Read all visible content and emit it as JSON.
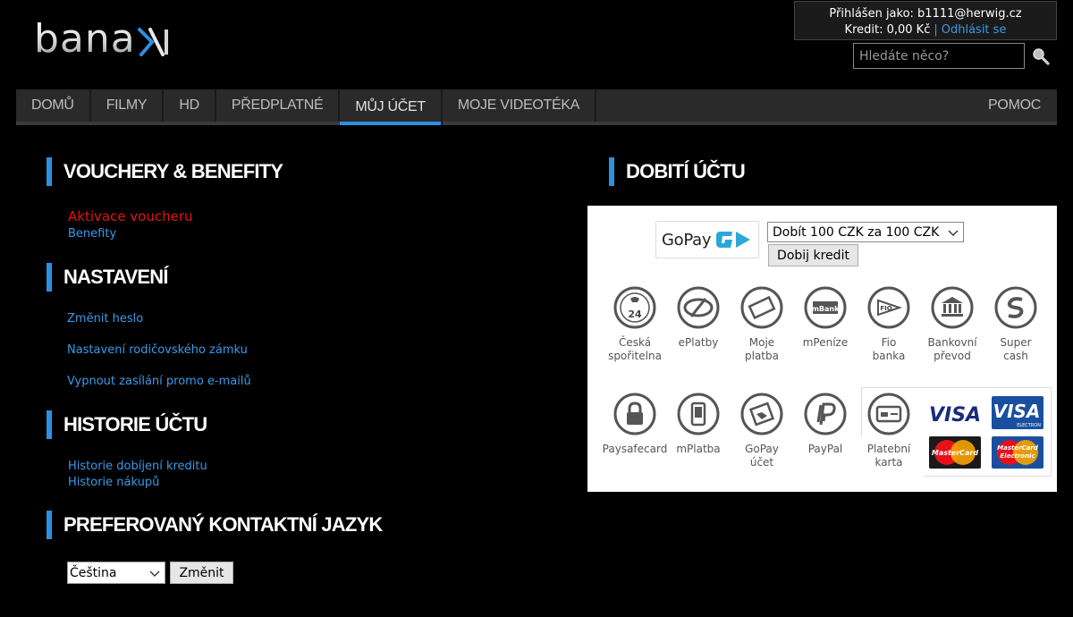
{
  "logo": {
    "text": "bana",
    "x_glyph": "X",
    "icon": "banaxi-x-icon"
  },
  "user": {
    "logged_in_label": "Přihlášen jako: b1111@herwig.cz",
    "credit_label": "Kredit: 0,00 Kč",
    "separator": "|",
    "logout_label": "Odhlásit se"
  },
  "search": {
    "placeholder": "Hledáte něco?",
    "icon": "search-icon"
  },
  "nav": {
    "items": [
      "DOMŮ",
      "FILMY",
      "HD",
      "PŘEDPLATNÉ",
      "MŮJ ÚČET",
      "MOJE VIDEOTÉKA"
    ],
    "active": "MŮJ ÚČET",
    "help": "POMOC"
  },
  "vouchers": {
    "title": "VOUCHERY & BENEFITY",
    "activate": "Aktivace voucheru",
    "benefits": "Benefity"
  },
  "settings": {
    "title": "NASTAVENÍ",
    "links": [
      "Změnit heslo",
      "Nastavení rodičovského zámku",
      "Vypnout zasílání promo e-mailů"
    ]
  },
  "history": {
    "title": "HISTORIE ÚČTU",
    "links": [
      "Historie dobíjení kreditu",
      "Historie nákupů"
    ]
  },
  "language": {
    "title": "PREFEROVANÝ KONTAKTNÍ JAZYK",
    "selected": "Čeština",
    "button": "Změnit"
  },
  "topup": {
    "title": "DOBITÍ ÚČTU",
    "gopay_label": "GoPay",
    "amount_selected": "Dobít 100 CZK za 100 CZK",
    "button": "Dobij kredit",
    "methods_row1": [
      {
        "label": "Česká\nspořitelna",
        "icon": "ceska-sporitelna-icon",
        "glyph": "24"
      },
      {
        "label": "ePlatby",
        "icon": "eplatby-icon"
      },
      {
        "label": "Moje\nplatba",
        "icon": "moje-platba-icon"
      },
      {
        "label": "mPeníze",
        "icon": "mpenize-icon",
        "glyph": "mBank"
      },
      {
        "label": "Fio\nbanka",
        "icon": "fio-banka-icon",
        "glyph": "FIO"
      },
      {
        "label": "Bankovní\npřevod",
        "icon": "bank-transfer-icon"
      },
      {
        "label": "Super\ncash",
        "icon": "super-cash-icon"
      }
    ],
    "methods_row2": [
      {
        "label": "Paysafecard",
        "icon": "paysafecard-icon"
      },
      {
        "label": "mPlatba",
        "icon": "mplatba-icon"
      },
      {
        "label": "GoPay\núčet",
        "icon": "gopay-account-icon"
      },
      {
        "label": "PayPal",
        "icon": "paypal-icon"
      },
      {
        "label": "Platební\nkarta",
        "icon": "payment-card-icon"
      }
    ],
    "card_logos": [
      "VISA",
      "VISA",
      "ELECTRON",
      "MasterCard",
      "MasterCard",
      "Electronic"
    ]
  },
  "colors": {
    "accent": "#2f8fe0",
    "link": "#3a9ae8",
    "alert": "#e81010",
    "background": "#000000"
  }
}
